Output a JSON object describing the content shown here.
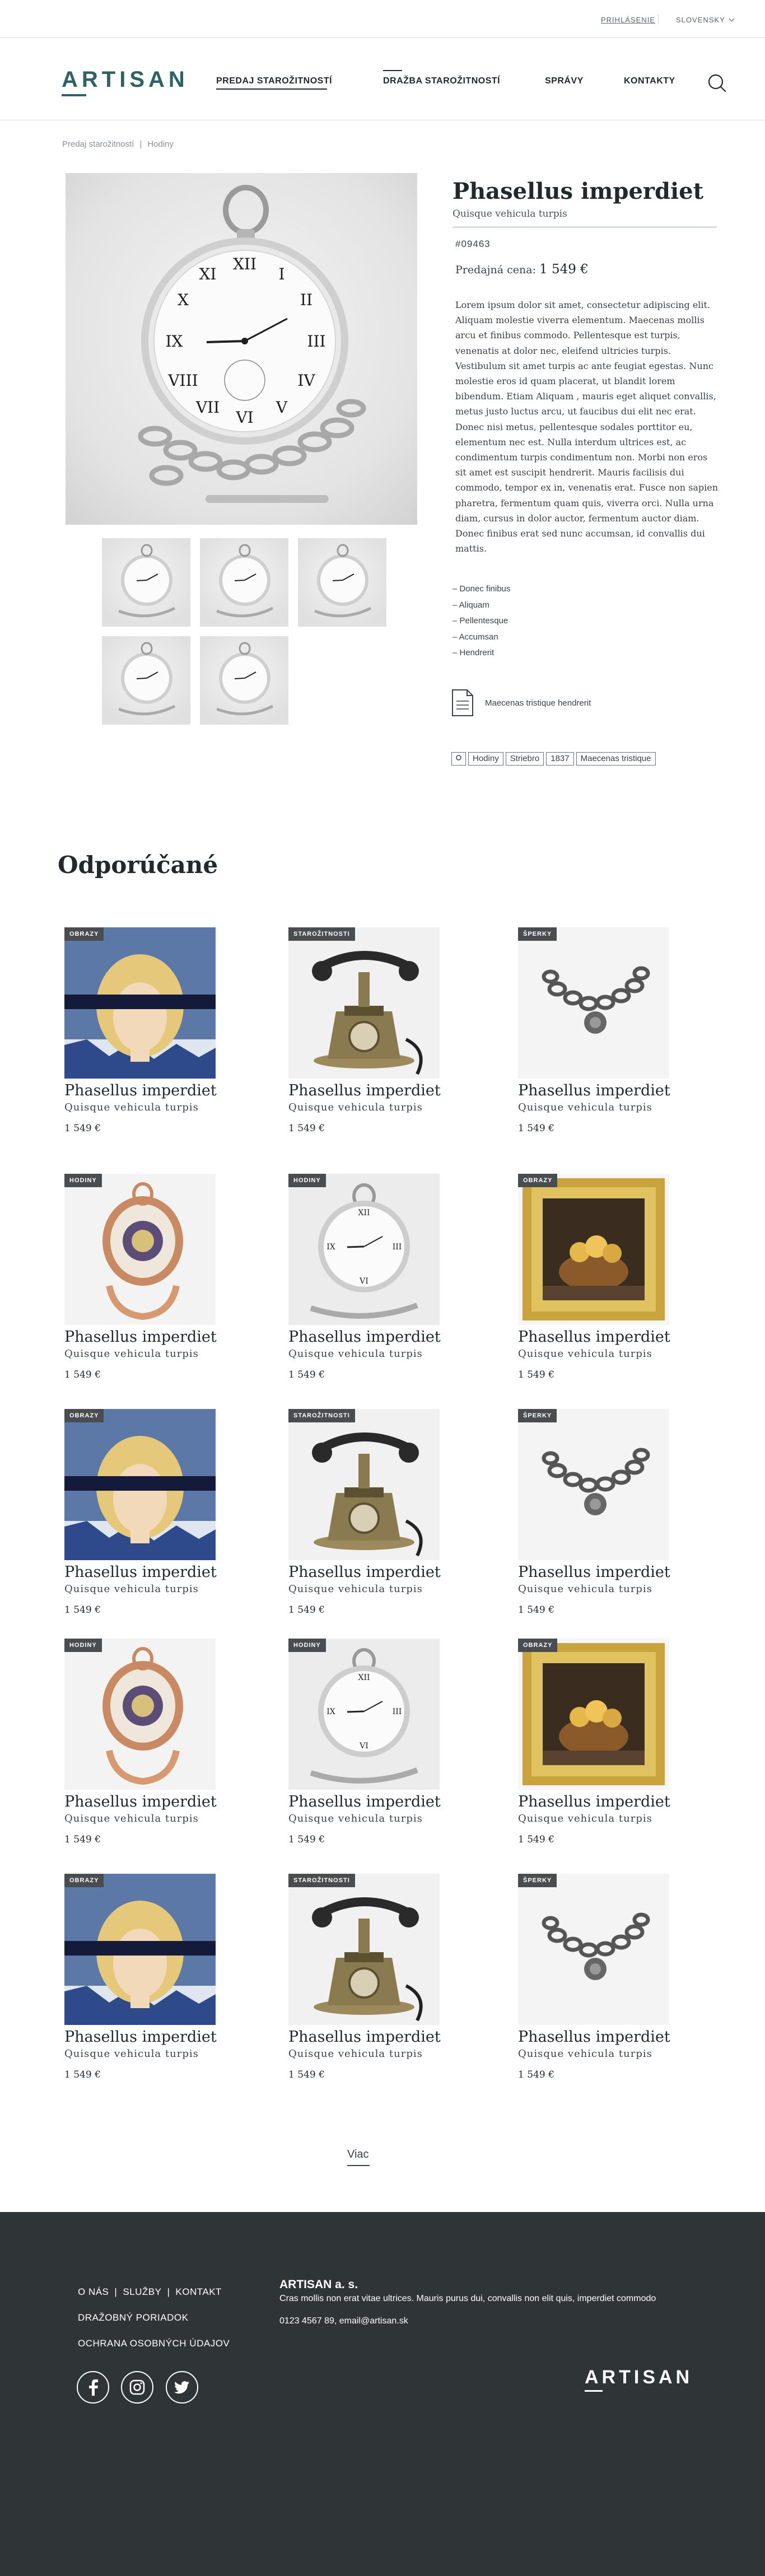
{
  "topbar": {
    "login_label": "PRIHLÁSENIE",
    "language_label": "SLOVENSKY"
  },
  "header": {
    "logo": "ARTISAN",
    "nav": [
      "PREDAJ STAROŽITNOSTÍ",
      "DRAŽBA STAROŽITNOSTÍ",
      "SPRÁVY",
      "KONTAKTY"
    ]
  },
  "breadcrumb": [
    "Predaj starožitností",
    "Hodiny"
  ],
  "product": {
    "title": "Phasellus imperdiet",
    "subtitle": "Quisque vehicula turpis",
    "code": "#09463",
    "price_label": "Predajná cena:",
    "price": "1 549 €",
    "description": "Lorem ipsum dolor sit amet, consectetur adipiscing elit. Aliquam molestie viverra elementum. Maecenas mollis arcu et finibus commodo. Pellentesque est turpis, venenatis at dolor nec, eleifend ultricies turpis. Vestibulum sit amet turpis ac ante feugiat egestas. Nunc molestie eros id quam placerat, ut blandit lorem bibendum. Etiam Aliquam , mauris eget aliquet convallis, metus justo luctus arcu, ut faucibus dui elit nec erat. Donec nisi metus, pellentesque sodales porttitor eu, elementum nec est. Nulla interdum ultrices est, ac condimentum turpis condimentum non. Morbi non eros sit amet est suscipit hendrerit. Mauris facilisis dui commodo, tempor ex in, venenatis erat. Fusce non sapien pharetra, fermentum quam quis, viverra orci. Nulla urna diam, cursus in dolor auctor, fermentum auctor diam. Donec finibus erat sed nunc accumsan, id convallis dui mattis.",
    "features": [
      "– Donec finibus",
      "– Aliquam",
      "– Pellentesque",
      "– Accumsan",
      "– Hendrerit"
    ],
    "document_label": "Maecenas tristique hendrerit",
    "tags": [
      "Hodiny",
      "Striebro",
      "1837",
      "Maecenas tristique"
    ]
  },
  "recommended": {
    "title": "Odporúčané",
    "items": [
      {
        "badge": "OBRAZY",
        "title": "Phasellus imperdiet",
        "subtitle": "Quisque vehicula turpis",
        "price": "1 549 €",
        "image": "painting-icon"
      },
      {
        "badge": "STAROŽITNOSTI",
        "title": "Phasellus imperdiet",
        "subtitle": "Quisque vehicula turpis",
        "price": "1 549 €",
        "image": "telephone-icon"
      },
      {
        "badge": "ŠPERKY",
        "title": "Phasellus imperdiet",
        "subtitle": "Quisque vehicula turpis",
        "price": "1 549 €",
        "image": "bracelet-icon"
      },
      {
        "badge": "HODINY",
        "title": "Phasellus imperdiet",
        "subtitle": "Quisque vehicula turpis",
        "price": "1 549 €",
        "image": "ornate-watch-icon"
      },
      {
        "badge": "HODINY",
        "title": "Phasellus imperdiet",
        "subtitle": "Quisque vehicula turpis",
        "price": "1 549 €",
        "image": "pocket-watch-icon"
      },
      {
        "badge": "OBRAZY",
        "title": "Phasellus imperdiet",
        "subtitle": "Quisque vehicula turpis",
        "price": "1 549 €",
        "image": "framed-painting-icon"
      },
      {
        "badge": "OBRAZY",
        "title": "Phasellus imperdiet",
        "subtitle": "Quisque vehicula turpis",
        "price": "1 549 €",
        "image": "painting-icon"
      },
      {
        "badge": "STAROŽITNOSTI",
        "title": "Phasellus imperdiet",
        "subtitle": "Quisque vehicula turpis",
        "price": "1 549 €",
        "image": "telephone-icon"
      },
      {
        "badge": "ŠPERKY",
        "title": "Phasellus imperdiet",
        "subtitle": "Quisque vehicula turpis",
        "price": "1 549 €",
        "image": "bracelet-icon"
      },
      {
        "badge": "HODINY",
        "title": "Phasellus imperdiet",
        "subtitle": "Quisque vehicula turpis",
        "price": "1 549 €",
        "image": "ornate-watch-icon"
      },
      {
        "badge": "HODINY",
        "title": "Phasellus imperdiet",
        "subtitle": "Quisque vehicula turpis",
        "price": "1 549 €",
        "image": "pocket-watch-icon"
      },
      {
        "badge": "OBRAZY",
        "title": "Phasellus imperdiet",
        "subtitle": "Quisque vehicula turpis",
        "price": "1 549 €",
        "image": "framed-painting-icon"
      },
      {
        "badge": "OBRAZY",
        "title": "Phasellus imperdiet",
        "subtitle": "Quisque vehicula turpis",
        "price": "1 549 €",
        "image": "painting-icon"
      },
      {
        "badge": "STAROŽITNOSTI",
        "title": "Phasellus imperdiet",
        "subtitle": "Quisque vehicula turpis",
        "price": "1 549 €",
        "image": "telephone-icon"
      },
      {
        "badge": "ŠPERKY",
        "title": "Phasellus imperdiet",
        "subtitle": "Quisque vehicula turpis",
        "price": "1 549 €",
        "image": "bracelet-icon"
      }
    ],
    "more_label": "Viac"
  },
  "footer": {
    "links": [
      "O NÁS",
      "SLUŽBY",
      "KONTAKT",
      "DRAŽOBNÝ PORIADOK",
      "OCHRANA OSOBNÝCH ÚDAJOV"
    ],
    "company": "ARTISAN a. s.",
    "text": "Cras mollis non erat vitae ultrices. Mauris purus dui, convallis non elit quis, imperdiet commodo",
    "contact": "0123 4567 89, email@artisan.sk",
    "logo": "ARTISAN",
    "social": [
      "facebook-icon",
      "instagram-icon",
      "twitter-icon"
    ]
  },
  "colors": {
    "brand": "#2f6166",
    "footer_bg": "#2f3537",
    "badge_bg": "#4a4d50"
  }
}
